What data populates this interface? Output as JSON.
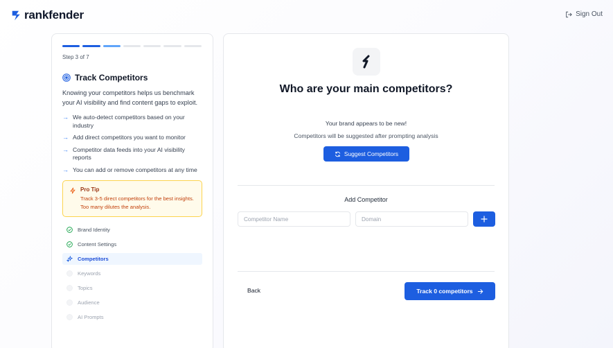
{
  "header": {
    "brand_name": "rankfender",
    "sign_out_label": "Sign Out"
  },
  "sidebar": {
    "progress": {
      "total_steps": 7,
      "current_step": 3
    },
    "step_label": "Step 3 of 7",
    "title": "Track Competitors",
    "description": "Knowing your competitors helps us benchmark your AI visibility and find content gaps to exploit.",
    "bullets": [
      "We auto-detect competitors based on your industry",
      "Add direct competitors you want to monitor",
      "Competitor data feeds into your AI visibility reports",
      "You can add or remove competitors at any time"
    ],
    "pro_tip": {
      "title": "Pro Tip",
      "text": "Track 3-5 direct competitors for the best insights. Too many dilutes the analysis."
    },
    "steps": [
      {
        "label": "Brand Identity",
        "status": "done"
      },
      {
        "label": "Content Settings",
        "status": "done"
      },
      {
        "label": "Competitors",
        "status": "active"
      },
      {
        "label": "Keywords",
        "status": "pending"
      },
      {
        "label": "Topics",
        "status": "pending"
      },
      {
        "label": "Audience",
        "status": "pending"
      },
      {
        "label": "AI Prompts",
        "status": "pending"
      }
    ]
  },
  "main": {
    "title": "Who are your main competitors?",
    "new_brand_text": "Your brand appears to be new!",
    "suggest_info": "Competitors will be suggested after prompting analysis",
    "suggest_button": "Suggest Competitors",
    "add_title": "Add Competitor",
    "name_placeholder": "Competitor Name",
    "domain_placeholder": "Domain",
    "back_label": "Back",
    "track_label": "Track 0 competitors"
  },
  "colors": {
    "primary": "#1d5ee0",
    "accent_light": "#60a5fa",
    "tip_bg": "#fffbeb",
    "tip_border": "#fcd34d",
    "tip_text": "#c2410c",
    "done_green": "#16a34a"
  }
}
